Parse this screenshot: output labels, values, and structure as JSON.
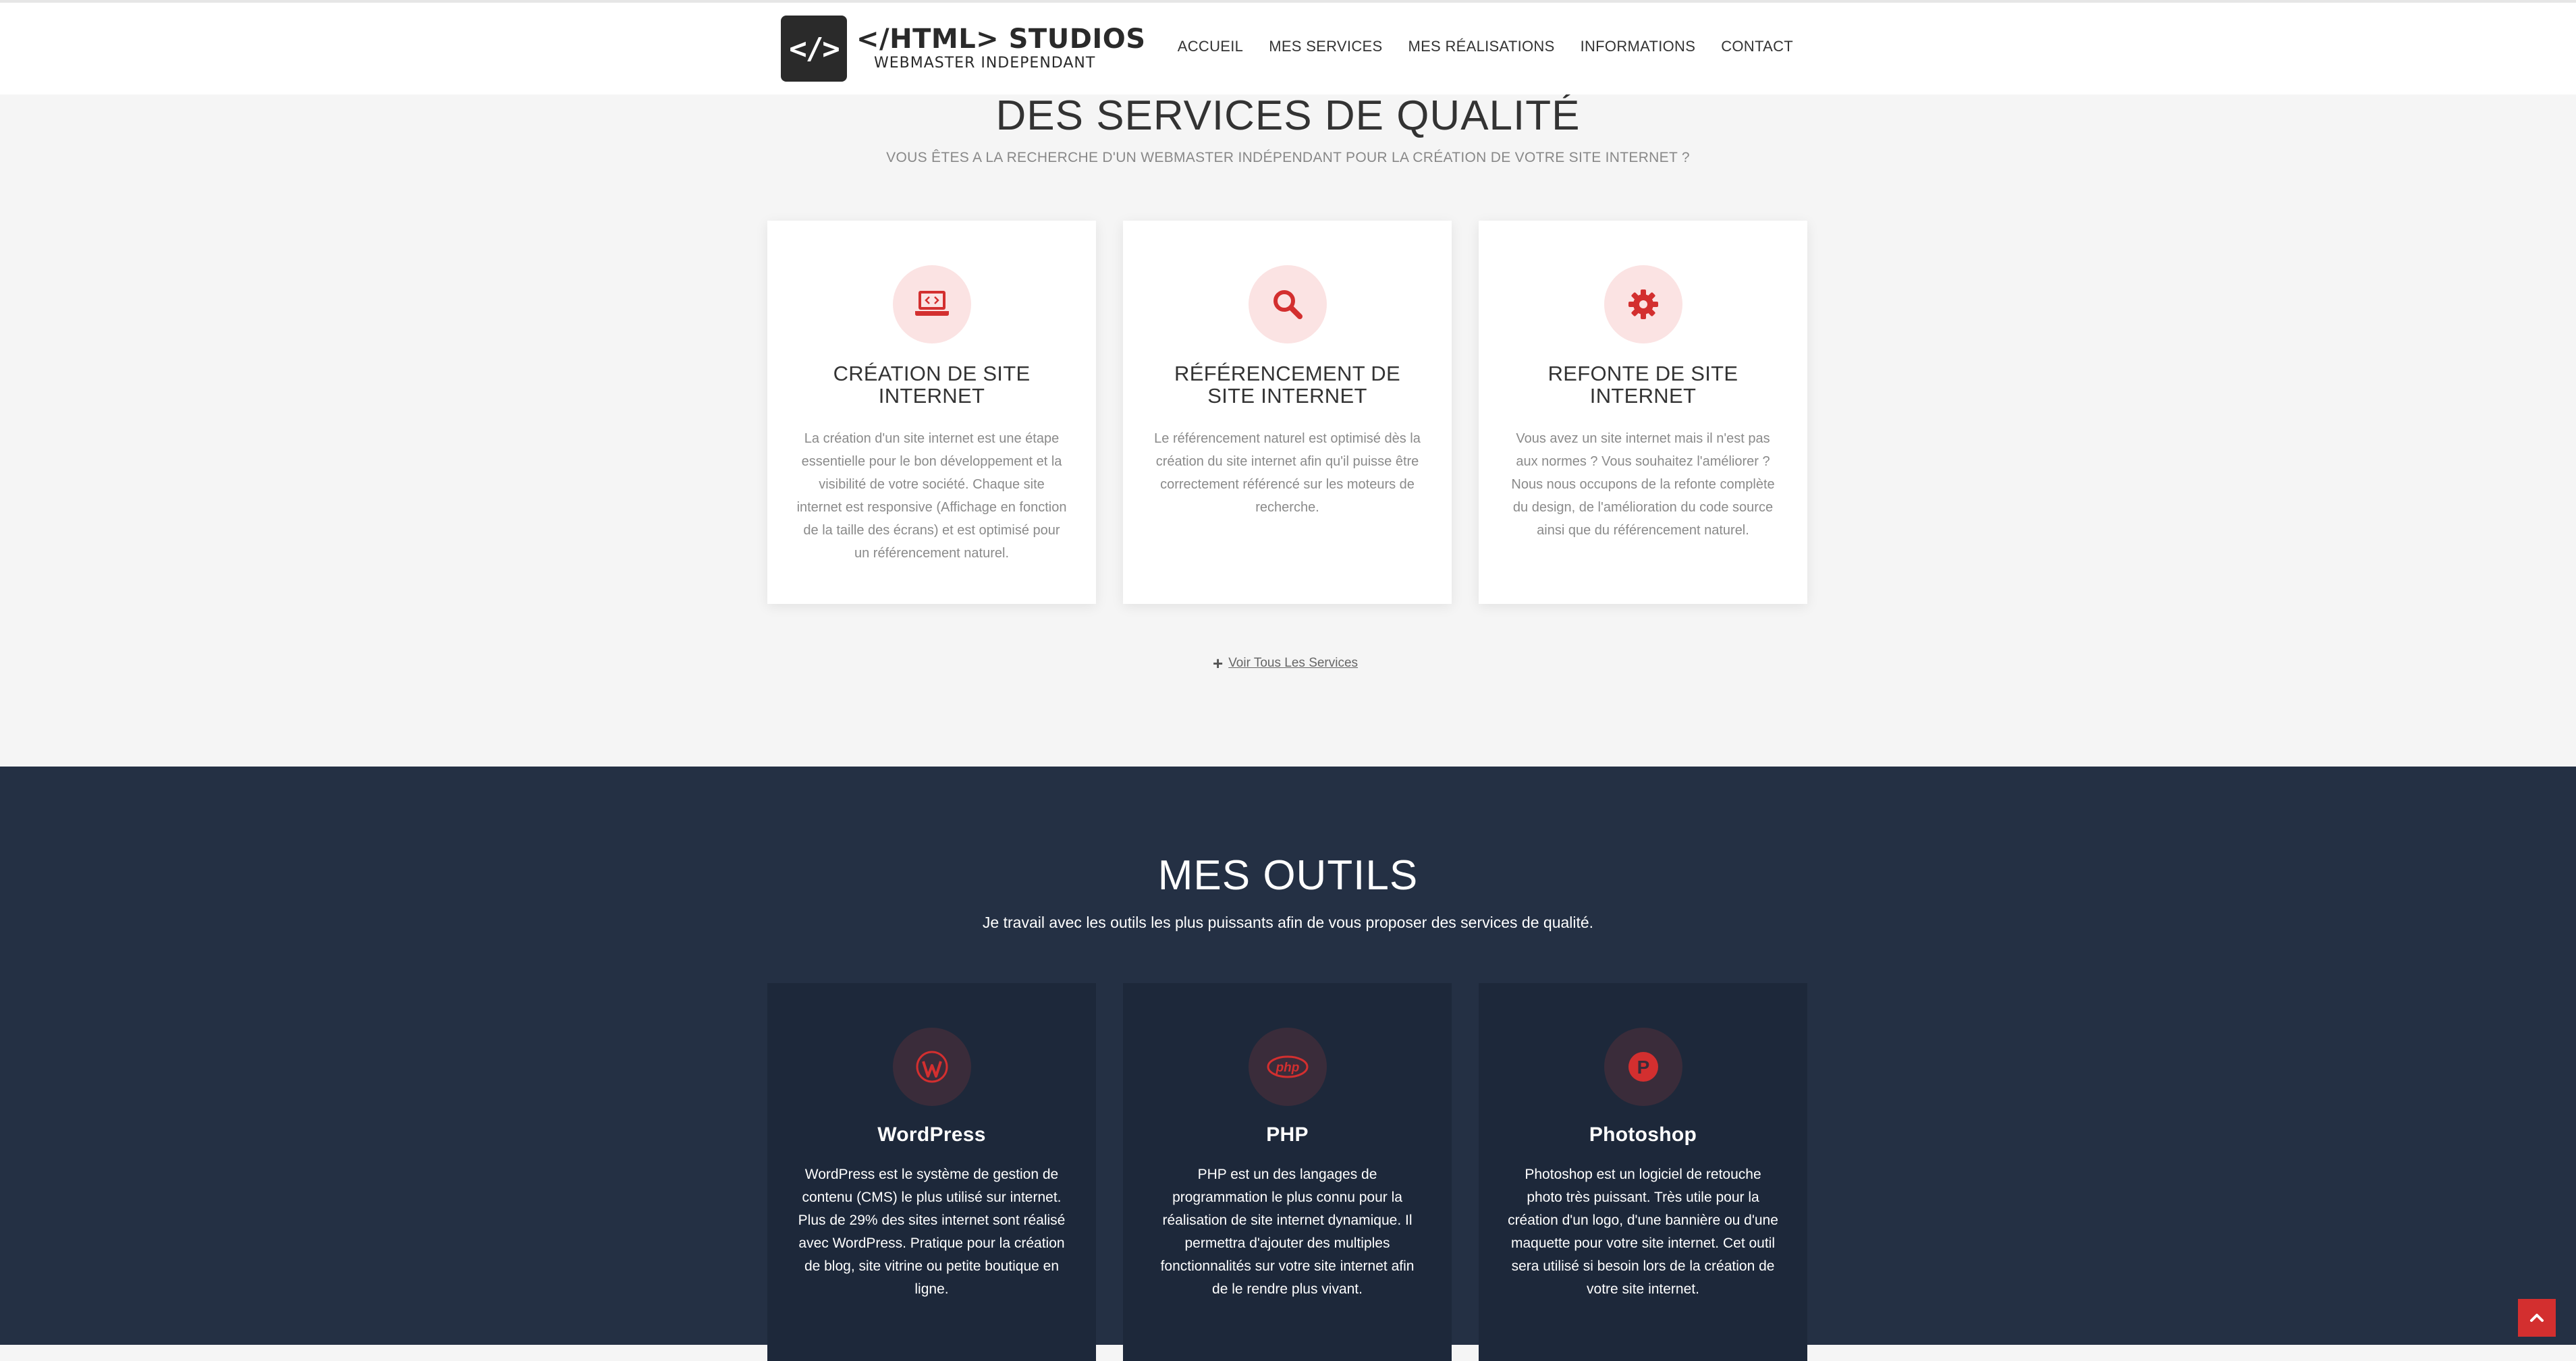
{
  "header": {
    "logo_mark": "</>",
    "logo_title": "</HTML> STUDIOS",
    "logo_subtitle": "WEBMASTER INDEPENDANT",
    "nav": [
      "ACCUEIL",
      "MES SERVICES",
      "MES RÉALISATIONS",
      "INFORMATIONS",
      "CONTACT"
    ]
  },
  "services": {
    "title": "DES SERVICES DE QUALITÉ",
    "subtitle": "VOUS ÊTES A LA RECHERCHE D'UN WEBMASTER INDÉPENDANT POUR LA CRÉATION DE VOTRE SITE INTERNET ?",
    "cards": [
      {
        "icon": "laptop-code-icon",
        "title": "CRÉATION DE SITE INTERNET",
        "text": "La création d'un site internet est une étape essentielle pour le bon développement et la visibilité de votre société. Chaque site internet est responsive (Affichage en fonction de la taille des écrans) et est optimisé pour un référencement naturel."
      },
      {
        "icon": "search-icon",
        "title": "RÉFÉRENCEMENT DE SITE INTERNET",
        "text": "Le référencement naturel est optimisé dès la création du site internet afin qu'il puisse être correctement référencé sur les moteurs de recherche."
      },
      {
        "icon": "gear-icon",
        "title": "REFONTE DE SITE INTERNET",
        "text": "Vous avez un site internet mais il n'est pas aux normes ? Vous souhaitez l'améliorer ? Nous nous occupons de la refonte complète du design, de l'amélioration du code source ainsi que du référencement naturel."
      }
    ],
    "see_all": "Voir Tous Les Services"
  },
  "tools": {
    "title": "MES OUTILS",
    "subtitle": "Je travail avec les outils les plus puissants afin de vous proposer des services de qualité.",
    "cards": [
      {
        "icon": "wordpress-icon",
        "title": "WordPress",
        "text": "WordPress est le système de gestion de contenu (CMS) le plus utilisé sur internet. Plus de 29% des sites internet sont réalisé avec WordPress. Pratique pour la création de blog, site vitrine ou petite boutique en ligne."
      },
      {
        "icon": "php-icon",
        "title": "PHP",
        "icon_label": "php",
        "text": "PHP est un des langages de programmation le plus connu pour la réalisation de site internet dynamique. Il permettra d'ajouter des multiples fonctionnalités sur votre site internet afin de le rendre plus vivant."
      },
      {
        "icon": "photoshop-icon",
        "title": "Photoshop",
        "icon_label": "P",
        "text": "Photoshop est un logiciel de retouche photo très puissant. Très utile pour la création d'un logo, d'une bannière ou d'une maquette pour votre site internet. Cet outil sera utilisé si besoin lors de la création de votre site internet."
      }
    ]
  },
  "colors": {
    "accent": "#d32f2f",
    "dark_bg": "#243044",
    "card_dark": "#1d283a",
    "light_bg": "#f5f5f5"
  }
}
